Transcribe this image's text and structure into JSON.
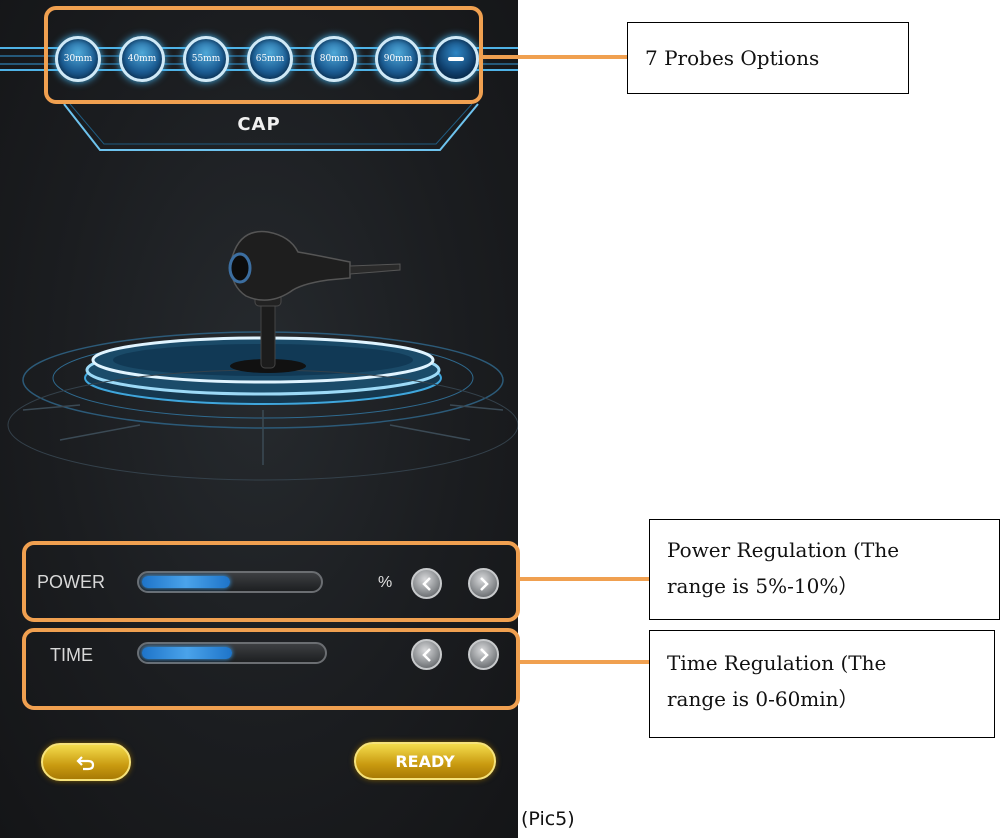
{
  "screen": {
    "probes": [
      "30mm",
      "40mm",
      "55mm",
      "65mm",
      "80mm",
      "90mm",
      ""
    ],
    "selected_probe_index": 6,
    "mode_label": "CAP",
    "power": {
      "label": "POWER",
      "unit": "%",
      "level": 0.5
    },
    "time": {
      "label": "TIME",
      "level": 0.5
    },
    "back_icon": "back-arrow-icon",
    "ready_label": "READY"
  },
  "callouts": {
    "probes": "7 Probes Options",
    "power_line1": "Power Regulation (The",
    "power_line2": "range is 5%-10%）",
    "time_line1": "Time Regulation (The",
    "time_line2": "range is 0-60min）"
  },
  "figure_label": "(Pic5)",
  "colors": {
    "accent_orange": "#f0a050",
    "glow_blue": "#2b9bd9",
    "gold": "#e2b82a"
  }
}
